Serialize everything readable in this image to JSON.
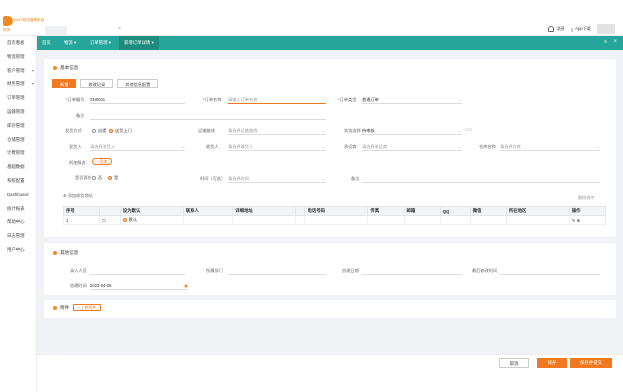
{
  "app": {
    "logo_text": "WMS物流管理系统",
    "logo_sub": "物流",
    "top_tab_close": "×"
  },
  "topbar": {
    "notify_label": "消息",
    "app_label": "App下载"
  },
  "sidebar": {
    "items": [
      {
        "label": "首页看板",
        "caret": ""
      },
      {
        "label": "物流管理",
        "caret": ""
      },
      {
        "label": "客户管理",
        "caret": "▾"
      },
      {
        "label": "财务管理",
        "caret": "▾"
      },
      {
        "label": "订单管理",
        "caret": ""
      },
      {
        "label": "运输管理",
        "caret": ""
      },
      {
        "label": "库存管理",
        "caret": ""
      },
      {
        "label": "仓储管理",
        "caret": ""
      },
      {
        "label": "计费管理",
        "caret": ""
      },
      {
        "label": "基础数据",
        "caret": ""
      },
      {
        "label": "系统配置",
        "caret": ""
      },
      {
        "label": "Dashboard",
        "caret": ""
      },
      {
        "label": "统计报表",
        "caret": ""
      },
      {
        "label": "帮助中心",
        "caret": ""
      },
      {
        "label": "日志管理",
        "caret": ""
      },
      {
        "label": "用户中心",
        "caret": ""
      }
    ]
  },
  "nav": {
    "items": [
      "首页",
      "物流 ▾",
      "订单管理 ▾",
      "新增订单详情 ▾"
    ],
    "close": "×",
    "menu": "≡"
  },
  "basic": {
    "title": "基本信息",
    "tabs": [
      "新增",
      "修改记录",
      "其他信息配置"
    ],
    "row1": {
      "order_no_label": "订单编号",
      "order_no_value": "SN0001",
      "order_name_label": "订单名称",
      "order_name_placeholder": "请输入订单名称",
      "order_type_label": "订单类型",
      "order_type_value": "普通订单"
    },
    "row2": {
      "remark_label": "备注"
    },
    "row3": {
      "ship_label": "发货方式",
      "ship_opt1": "自提",
      "ship_opt2": "送货上门",
      "route_label": "运输路线",
      "route_placeholder": "请选择运输路线",
      "status_label": "状态选择",
      "status_value": "待审核"
    },
    "row4": {
      "sender_label": "发货人",
      "sender_placeholder": "请选择发货人",
      "receiver_label": "收货人",
      "receiver_placeholder": "请选择收货人",
      "carrier_label": "承运商",
      "carrier_placeholder": "请选择承运商",
      "warehouse_label": "仓库名称",
      "warehouse_placeholder": "请选择仓库"
    },
    "row5": {
      "extra_label": "附加服务",
      "extra_btn": "+添加"
    },
    "row6": {
      "insured_label": "是否保价",
      "insured_no": "否",
      "insured_yes": "是",
      "time_label": "时间（可选）",
      "time_placeholder": "请选择时间",
      "memo_label": "备注"
    },
    "add_row_label": "添加收货地址"
  },
  "table": {
    "headers": [
      "序号",
      "",
      "设为默认",
      "联系人",
      "详细地址",
      "",
      "电话号码",
      "传真",
      "邮箱",
      "QQ",
      "微信",
      "所在地区",
      "操作"
    ],
    "rows": [
      {
        "index": "1",
        "default": "默认"
      }
    ],
    "corner_label": "删除选中"
  },
  "extra": {
    "title": "其他信息",
    "fields": [
      {
        "label": "录入人员"
      },
      {
        "label": "所属部门"
      },
      {
        "label": "创建日期"
      },
      {
        "label": "最后修改时间"
      }
    ],
    "date_label": "创建时间",
    "date_value": "2023-04-06"
  },
  "attach": {
    "title": "附件",
    "btn": "+上传附件"
  },
  "footer": {
    "cancel": "取消",
    "save": "保存",
    "save_submit": "保存并提交"
  }
}
